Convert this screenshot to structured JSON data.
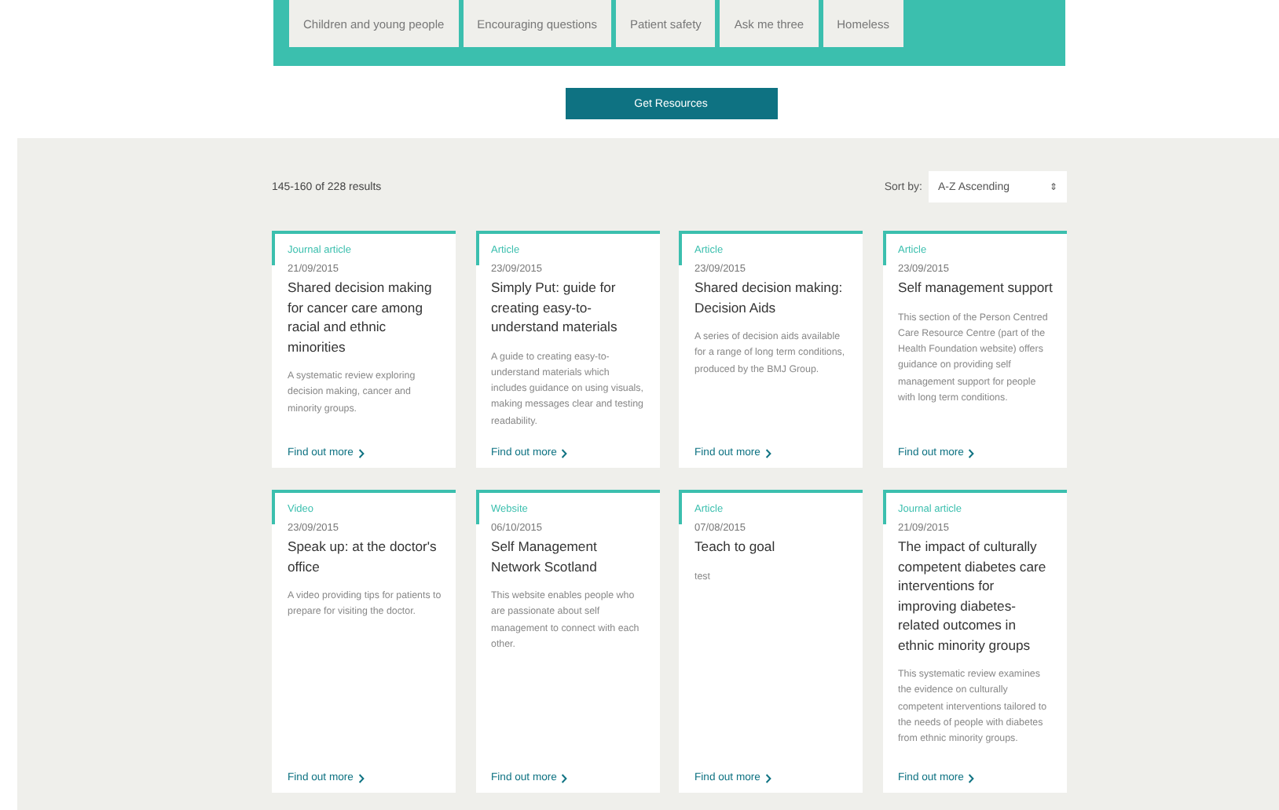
{
  "filter_tabs": [
    {
      "label": "Children and young people"
    },
    {
      "label": "Encouraging questions"
    },
    {
      "label": "Patient safety"
    },
    {
      "label": "Ask me three"
    },
    {
      "label": "Homeless"
    }
  ],
  "get_resources_button": "Get Resources",
  "results_count": "145-160 of 228 results",
  "sort": {
    "label": "Sort by:",
    "value": "A-Z Ascending",
    "arrow": "⇕"
  },
  "cards": [
    {
      "type": "Journal article",
      "date": "21/09/2015",
      "title": "Shared decision making for cancer care among racial and ethnic minorities",
      "description": "A systematic review exploring decision making, cancer and minority groups.",
      "link": "Find out more"
    },
    {
      "type": "Article",
      "date": "23/09/2015",
      "title": "Simply Put: guide for creating easy-to-understand materials",
      "description": "A guide to creating easy-to-understand materials which includes guidance on using visuals, making messages clear and testing readability.",
      "link": "Find out more"
    },
    {
      "type": "Article",
      "date": "23/09/2015",
      "title": "Shared decision making: Decision Aids",
      "description": "A series of decision aids available for a range of long term conditions, produced by the BMJ Group.",
      "link": "Find out more"
    },
    {
      "type": "Article",
      "date": "23/09/2015",
      "title": "Self management support",
      "description": "This section of the Person Centred Care Resource Centre (part of the Health Foundation website) offers guidance on providing self management support for people with long term conditions.",
      "link": "Find out more"
    },
    {
      "type": "Video",
      "date": "23/09/2015",
      "title": "Speak up: at the doctor's office",
      "description": "A video providing tips for patients to prepare for visiting the doctor.",
      "link": "Find out more"
    },
    {
      "type": "Website",
      "date": "06/10/2015",
      "title": "Self Management Network Scotland",
      "description": "This website enables people who are passionate about self management to connect with each other.",
      "link": "Find out more"
    },
    {
      "type": "Article",
      "date": "07/08/2015",
      "title": "Teach to goal",
      "description": "test",
      "link": "Find out more"
    },
    {
      "type": "Journal article",
      "date": "21/09/2015",
      "title": "The impact of culturally competent diabetes care interventions for improving diabetes-related outcomes in ethnic minority groups",
      "description": "This systematic review examines the evidence on culturally competent interventions tailored to the needs of people with diabetes from ethnic minority groups.",
      "link": "Find out more"
    }
  ]
}
